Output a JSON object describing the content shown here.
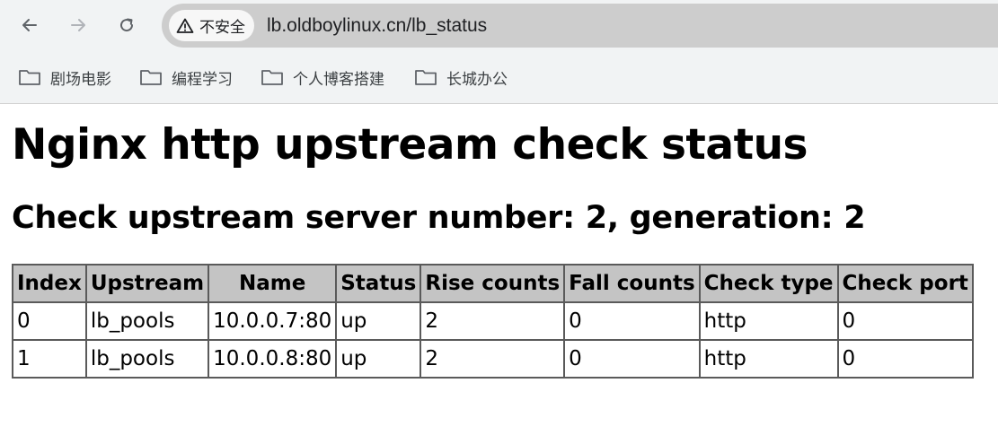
{
  "browser": {
    "security_label": "不安全",
    "url": "lb.oldboylinux.cn/lb_status",
    "bookmarks": [
      {
        "label": "剧场电影"
      },
      {
        "label": "编程学习"
      },
      {
        "label": "个人博客搭建"
      },
      {
        "label": "长城办公"
      }
    ]
  },
  "page": {
    "title": "Nginx http upstream check status",
    "subtitle": "Check upstream server number: 2, generation: 2",
    "table": {
      "headers": [
        "Index",
        "Upstream",
        "Name",
        "Status",
        "Rise counts",
        "Fall counts",
        "Check type",
        "Check port"
      ],
      "rows": [
        [
          "0",
          "lb_pools",
          "10.0.0.7:80",
          "up",
          "2",
          "0",
          "http",
          "0"
        ],
        [
          "1",
          "lb_pools",
          "10.0.0.8:80",
          "up",
          "2",
          "0",
          "http",
          "0"
        ]
      ]
    }
  }
}
